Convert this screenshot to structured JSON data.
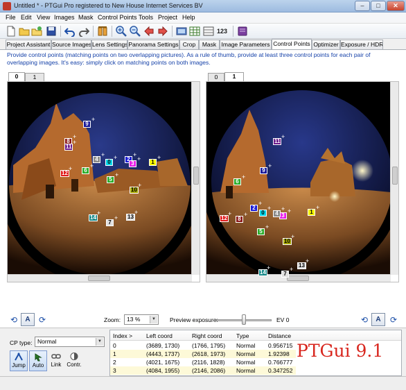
{
  "window": {
    "title": "Untitled * - PTGui Pro registered to New House Internet Services BV",
    "minimize": "–",
    "maximize": "□",
    "close": "✕"
  },
  "menu": [
    "File",
    "Edit",
    "View",
    "Images",
    "Mask",
    "Control Points",
    "Tools",
    "Project",
    "Help"
  ],
  "toolbar": {
    "icons": [
      "new-file-icon",
      "open-folder-icon",
      "open-recent-icon",
      "save-icon",
      "undo-icon",
      "redo-icon",
      "control-points-tool-icon",
      "zoom-in-icon",
      "zoom-out-icon",
      "previous-icon",
      "next-icon",
      "panorama-editor-icon",
      "table-icon",
      "cp-table-icon",
      "numbers-icon",
      "help-book-icon"
    ],
    "numbers_label": "123"
  },
  "tabs": [
    "Project Assistant",
    "Source Images",
    "Lens Settings",
    "Panorama Settings",
    "Crop",
    "Mask",
    "Image Parameters",
    "Control Points",
    "Optimizer",
    "Exposure / HDR"
  ],
  "active_tab": "Control Points",
  "info_text": "Provide control points (matching points on two overlapping pictures). As a rule of thumb, provide at least three control points for each pair of overlapping images. It's easy: simply click on matching points on both images.",
  "left_image": {
    "tabs": [
      "0",
      "1"
    ],
    "active": "0"
  },
  "right_image": {
    "tabs": [
      "0",
      "1"
    ],
    "active": "1"
  },
  "control_point_colors": {
    "0": "#00d6e8",
    "1": "#f5f500",
    "2": "#1a1ad6",
    "3": "#e81ae8",
    "4": "#8a8a8a",
    "5": "#2cae2c",
    "6": "#2cae2c",
    "7": "#e0e0e0",
    "8": "#8b1a1a",
    "9": "#1a1a9a",
    "10": "#a8a800",
    "11": "#6a1a8a",
    "12": "#e01a1a",
    "13": "#e0e0e0",
    "14": "#1a8a8a"
  },
  "controls": {
    "zoom_label": "Zoom:",
    "zoom_value": "13 %",
    "preview_exposure_label": "Preview exposure:",
    "ev_value": "EV 0",
    "auto_align_label": "A"
  },
  "cp_panel": {
    "cp_type_label": "CP type:",
    "cp_type_value": "Normal",
    "tools": [
      "Jump",
      "Auto",
      "Link",
      "Contr."
    ]
  },
  "cp_table": {
    "columns": [
      "Index >",
      "Left coord",
      "Right coord",
      "Type",
      "Distance"
    ],
    "rows": [
      [
        "0",
        "(3689, 1730)",
        "(1766, 1795)",
        "Normal",
        "0.956715"
      ],
      [
        "1",
        "(4443, 1737)",
        "(2618, 1973)",
        "Normal",
        "1.92398"
      ],
      [
        "2",
        "(4021, 1675)",
        "(2116, 1828)",
        "Normal",
        "0.766777"
      ],
      [
        "3",
        "(4084, 1955)",
        "(2146, 2086)",
        "Normal",
        "0.347252"
      ]
    ]
  },
  "watermark": "PTGui 9.1"
}
